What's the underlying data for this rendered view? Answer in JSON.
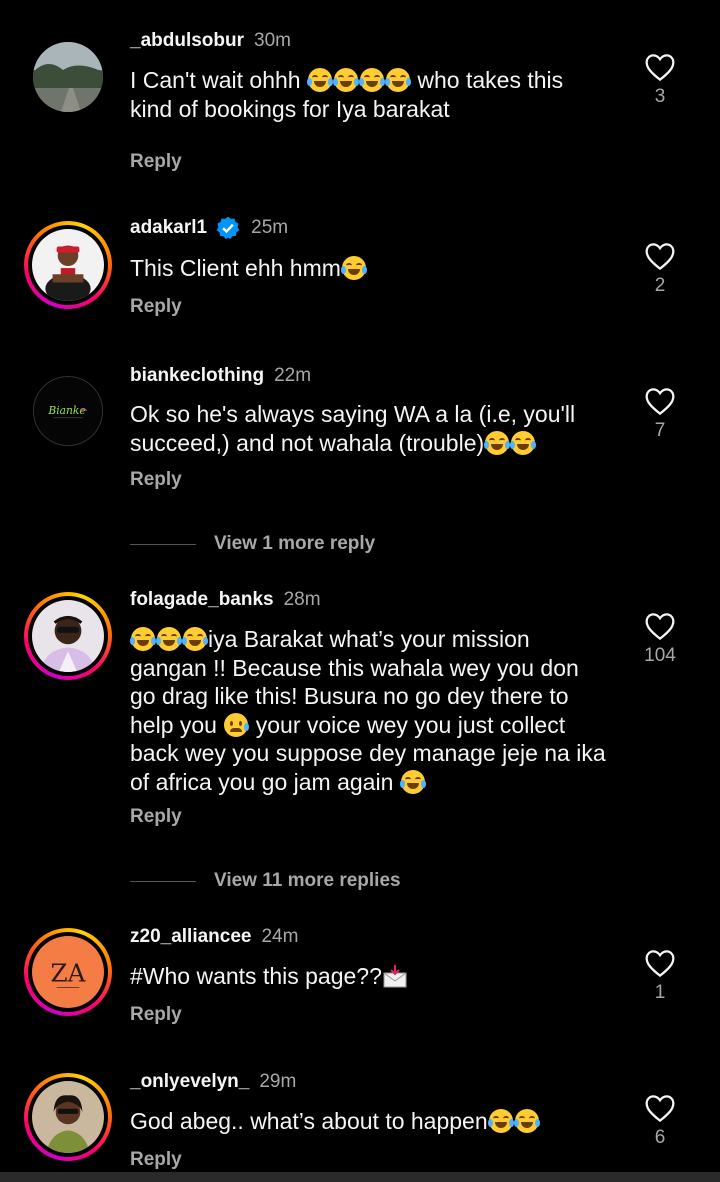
{
  "comments": [
    {
      "username": "_abdulsobur",
      "time": "30m",
      "text_a": "I Can't wait ohhh ",
      "text_b": " who takes this kind of bookings for Iya barakat",
      "likes": "3",
      "reply": "Reply",
      "avatar": "landscape-photo",
      "verified": false
    },
    {
      "username": "adakarl1",
      "time": "25m",
      "text_a": "This Client ehh hmm",
      "likes": "2",
      "reply": "Reply",
      "avatar": "person-red-cap-photo",
      "verified": true
    },
    {
      "username": "biankeclothing",
      "time": "22m",
      "text_a": "Ok so he's always saying WA a la (i.e, you'll succeed,) and not wahala (trouble)",
      "likes": "7",
      "reply": "Reply",
      "avatar": "bianke-logo",
      "avatar_logo_text": "Bianke",
      "verified": false
    },
    {
      "username": "folagade_banks",
      "time": "28m",
      "text_a": "iya Barakat what’s your mission gangan !! Because this wahala wey you don go drag like this! Busura no go dey there to help you ",
      "text_b": " your voice wey you just collect back wey you suppose dey manage jeje na ika of africa you go jam again ",
      "likes": "104",
      "reply": "Reply",
      "avatar": "man-sunglasses-photo",
      "verified": false
    },
    {
      "username": "z20_alliancee",
      "time": "24m",
      "text_a": "#Who wants this page??",
      "likes": "1",
      "reply": "Reply",
      "avatar": "za-logo",
      "avatar_logo_text": "ZA",
      "verified": false
    },
    {
      "username": "_onlyevelyn_",
      "time": "29m",
      "text_a": "God abeg.. what’s about to happen",
      "likes": "6",
      "reply": "Reply",
      "avatar": "woman-sunglasses-photo",
      "verified": false
    }
  ],
  "view_more": [
    {
      "label": "View 1 more reply"
    },
    {
      "label": "View 11 more replies"
    }
  ],
  "icons": {
    "like": "heart-outline-icon",
    "verified": "verified-badge-icon",
    "emoji_laugh": "tears-of-joy-emoji",
    "emoji_sad": "crying-face-emoji",
    "mail": "incoming-envelope-icon"
  },
  "colors": {
    "background": "#000000",
    "primary_text": "#f5f5f5",
    "secondary_text": "#a8a8a8",
    "verified_blue": "#0095f6",
    "za_avatar_orange": "#f47c45"
  }
}
